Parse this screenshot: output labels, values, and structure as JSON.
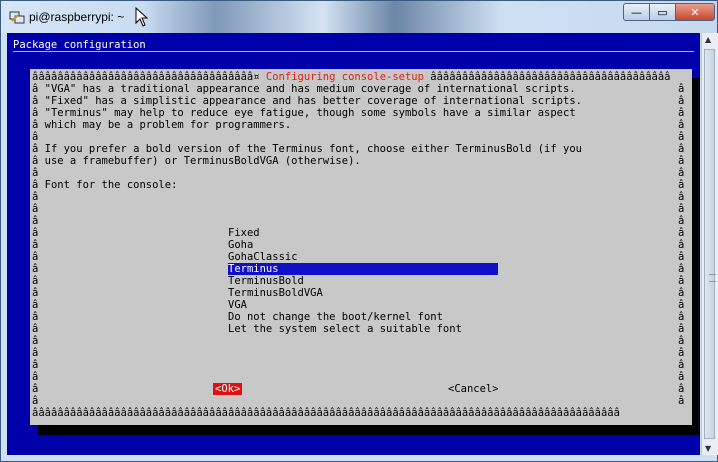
{
  "window": {
    "title": "pi@raspberrypi: ~"
  },
  "controls": {
    "minimize": "—",
    "maximize": "▭",
    "close": "✕"
  },
  "terminal": {
    "header": "Package configuration",
    "dialog": {
      "top_border_left": "âââââââââââââââââââââââââââââââââââ¤ ",
      "title": "Configuring console-setup",
      "top_border_right": " ââââââââââââââââââââââââââââââââââââââ",
      "lines": [
        "â \"VGA\" has a traditional appearance and has medium coverage of international scripts.",
        "â \"Fixed\" has a simplistic appearance and has better coverage of international scripts.",
        "â \"Terminus\" may help to reduce eye fatigue, though some symbols have a similar aspect",
        "â which may be a problem for programmers.",
        "â",
        "â If you prefer a bold version of the Terminus font, choose either TerminusBold (if you",
        "â use a framebuffer) or TerminusBoldVGA (otherwise).",
        "â",
        "â Font for the console:",
        "â",
        "â",
        "â",
        "â",
        "â",
        "â",
        "â",
        "â",
        "â",
        "â",
        "â",
        "â",
        "â",
        "â",
        "â",
        "â",
        "â",
        "â"
      ],
      "right_border": "â",
      "options": [
        "Fixed",
        "Goha",
        "GohaClassic",
        "Terminus",
        "TerminusBold",
        "TerminusBoldVGA",
        "VGA",
        "Do not change the boot/kernel font",
        "Let the system select a suitable font"
      ],
      "selected_option": "Terminus",
      "ok_label": "<Ok>",
      "cancel_label": "<Cancel>",
      "bottom_border": "âââââââââââââââââââââââââââââââââââââââââââââââââââââââââââââââââââââââââââââââââââââââââââââ"
    }
  },
  "colors": {
    "terminal_bg": "#0000aa",
    "dialog_bg": "#c8c8c8",
    "title_red": "#e02010",
    "highlight": "#1010c8",
    "ok_bg": "#e01010"
  }
}
